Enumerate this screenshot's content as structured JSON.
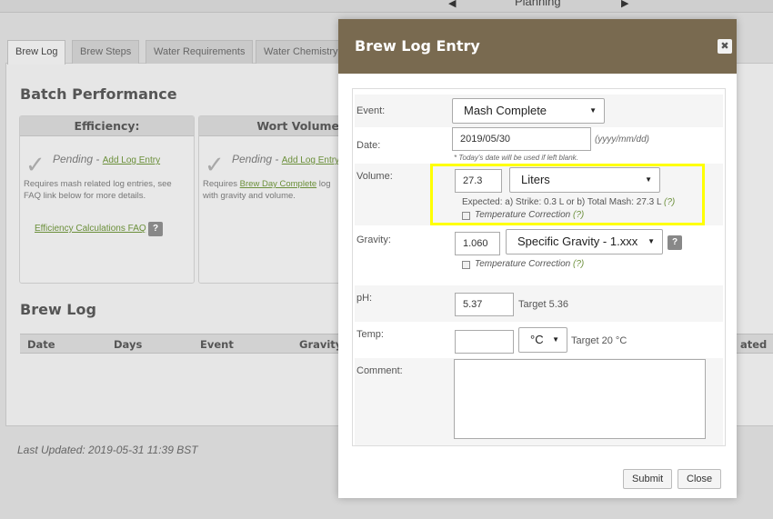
{
  "top_nav": {
    "prev_arrow": "◀",
    "next_arrow": "▶",
    "title": "Planning"
  },
  "tabs": [
    {
      "label": "Brew Log"
    },
    {
      "label": "Brew Steps"
    },
    {
      "label": "Water Requirements"
    },
    {
      "label": "Water Chemistry"
    }
  ],
  "batch_performance": {
    "title": "Batch Performance",
    "cards": [
      {
        "heading": "Efficiency:",
        "status": "Pending",
        "link": "Add Log Entry",
        "desc_line1": "Requires mash related log entries, see",
        "desc_line2": "FAQ link below for more details.",
        "faq_link": "Efficiency Calculations FAQ",
        "faq_q": "?"
      },
      {
        "heading": "Wort Volume:",
        "status": "Pending",
        "link": "Add Log Entry",
        "desc_pre": "Requires ",
        "desc_link": "Brew Day Complete",
        "desc_post": " log",
        "desc_line2": "with gravity and volume."
      }
    ]
  },
  "brew_log": {
    "title": "Brew Log",
    "columns": [
      "Date",
      "Days",
      "Event",
      "Gravity",
      "ated"
    ]
  },
  "last_updated": "Last Updated: 2019-05-31 11:39 BST",
  "modal": {
    "title": "Brew Log Entry",
    "close_icon": "✖",
    "event": {
      "label": "Event:",
      "value": "Mash Complete"
    },
    "date": {
      "label": "Date:",
      "value": "2019/05/30",
      "format_hint": "(yyyy/mm/dd)",
      "note": "* Today's date will be used if left blank."
    },
    "volume": {
      "label": "Volume:",
      "value": "27.3",
      "unit": "Liters",
      "expected_text": "Expected: a) Strike: 0.3 L or b) Total Mash: 27.3 L",
      "help": "(?)",
      "temp_correction": "Temperature Correction",
      "temp_help": "(?)"
    },
    "gravity": {
      "label": "Gravity:",
      "value": "1.060",
      "unit": "Specific Gravity - 1.xxx",
      "help_btn": "?",
      "temp_correction": "Temperature Correction",
      "temp_help": "(?)"
    },
    "ph": {
      "label": "pH:",
      "value": "5.37",
      "target": "Target 5.36"
    },
    "temp": {
      "label": "Temp:",
      "value": "",
      "unit": "°C",
      "target": "Target 20 °C"
    },
    "comment": {
      "label": "Comment:",
      "value": ""
    },
    "submit_label": "Submit",
    "close_label": "Close"
  },
  "colors": {
    "modal_header": "#796a50",
    "highlight": "#ffff00",
    "link_green": "#6b8f3a"
  }
}
